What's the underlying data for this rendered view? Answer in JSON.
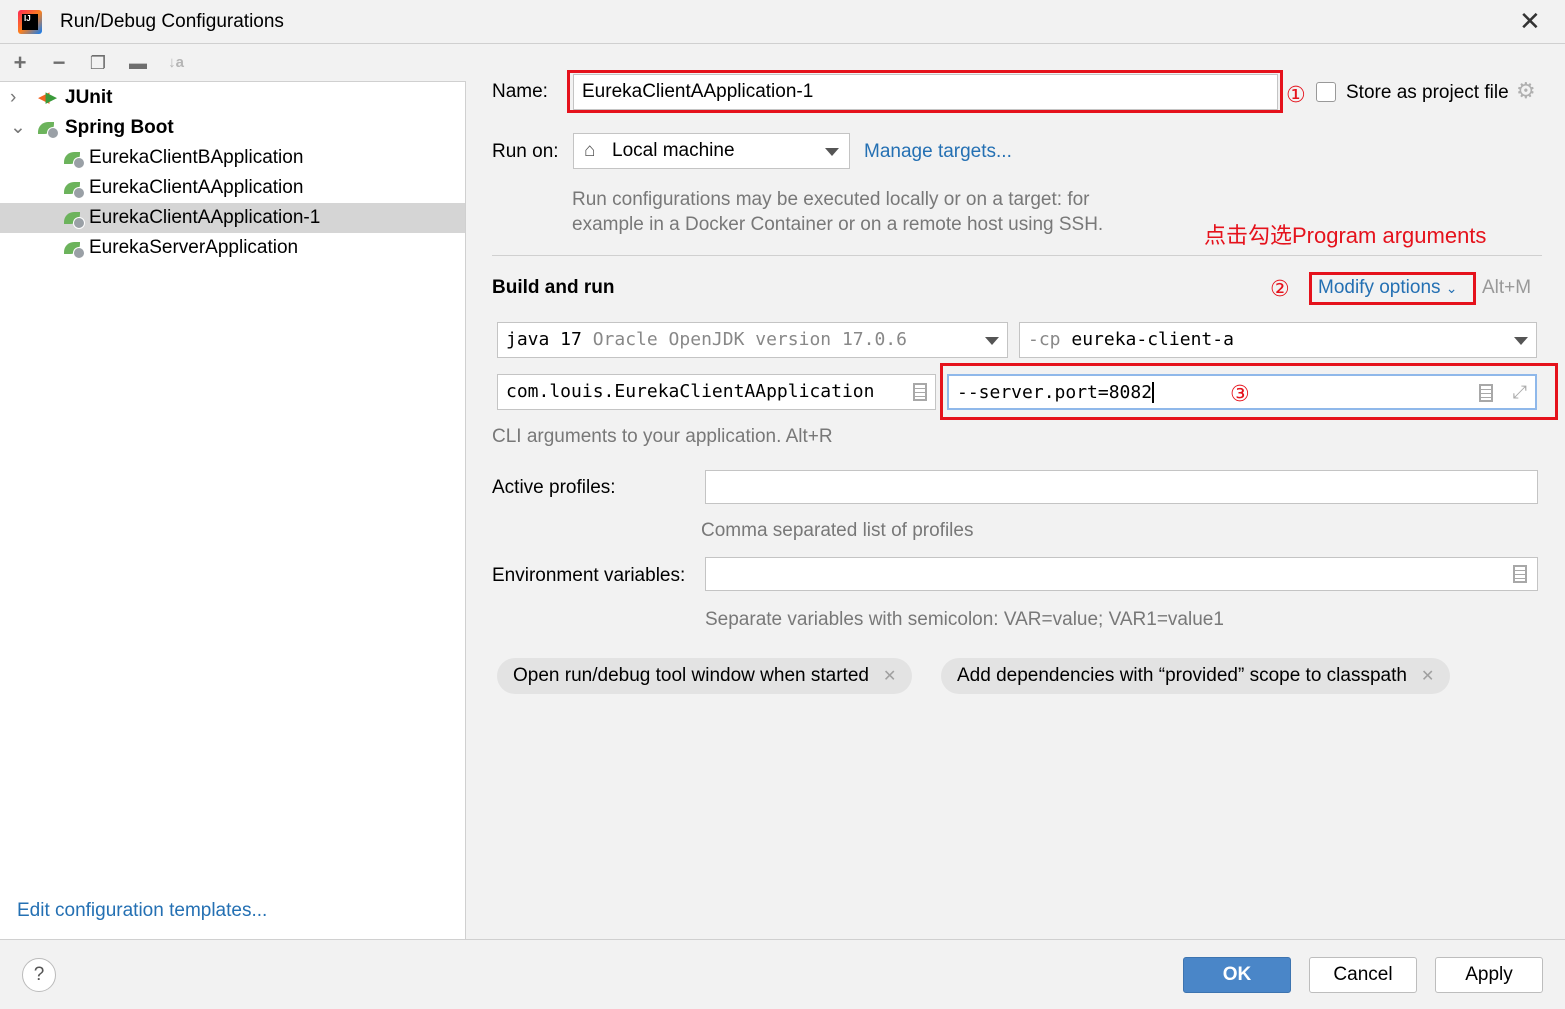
{
  "window": {
    "title": "Run/Debug Configurations",
    "close_icon": "close-icon"
  },
  "tree": {
    "groups": [
      {
        "label": "JUnit",
        "expanded": false
      },
      {
        "label": "Spring Boot",
        "expanded": true
      }
    ],
    "items": [
      "EurekaClientBApplication",
      "EurekaClientAApplication",
      "EurekaClientAApplication-1",
      "EurekaServerApplication"
    ],
    "selected": "EurekaClientAApplication-1",
    "edit_templates": "Edit configuration templates..."
  },
  "form": {
    "name_label": "Name:",
    "name_value": "EurekaClientAApplication-1",
    "store_label": "Store as project file",
    "store_checked": false,
    "runon_label": "Run on:",
    "runon_value": "Local machine",
    "manage_targets": "Manage targets...",
    "runon_hint1": "Run configurations may be executed locally or on a target: for",
    "runon_hint2": "example in a Docker Container or on a remote host using SSH.",
    "build_run": "Build and run",
    "modify_options": "Modify options",
    "modify_shortcut": "Alt+M",
    "jdk_main": "java 17",
    "jdk_detail": "Oracle OpenJDK version 17.0.6",
    "cp_prefix": "-cp",
    "cp_value": "eureka-client-a",
    "main_class": "com.louis.EurekaClientAApplication",
    "program_args": "--server.port=8082",
    "cli_hint": "CLI arguments to your application. Alt+R",
    "profiles_label": "Active profiles:",
    "profiles_value": "",
    "profiles_hint": "Comma separated list of profiles",
    "env_label": "Environment variables:",
    "env_value": "",
    "env_hint": "Separate variables with semicolon: VAR=value; VAR1=value1",
    "chips": [
      "Open run/debug tool window when started",
      "Add dependencies with “provided” scope to classpath"
    ]
  },
  "annotations": {
    "step1": "①",
    "step2": "②",
    "step3": "③",
    "note": "点击勾选Program arguments",
    "color": "#e5121c"
  },
  "buttons": {
    "ok": "OK",
    "cancel": "Cancel",
    "apply": "Apply",
    "help": "?"
  }
}
